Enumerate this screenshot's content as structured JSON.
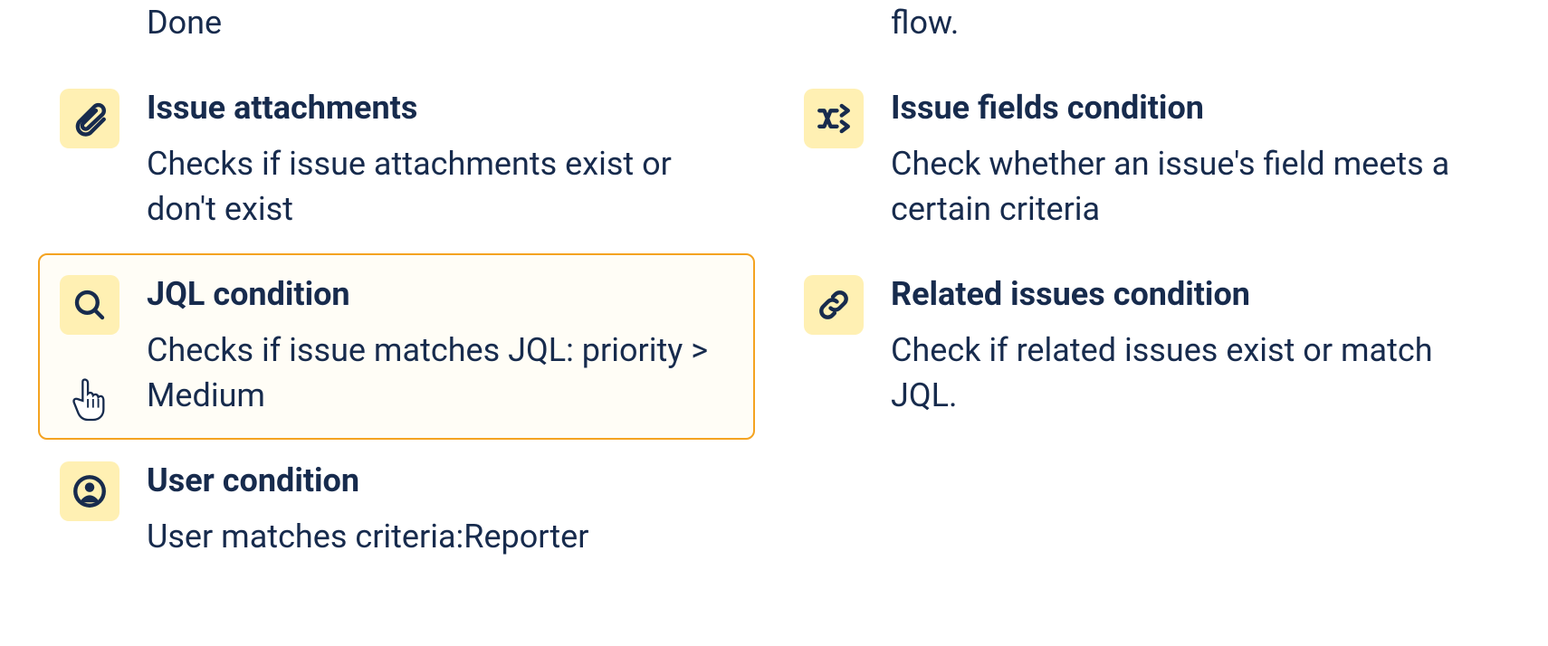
{
  "left": {
    "partial_top_desc": "Done",
    "items": [
      {
        "icon": "paperclip-icon",
        "title": "Issue attachments",
        "desc": "Checks if issue attachments exist or don't exist"
      },
      {
        "icon": "search-icon",
        "title": "JQL condition",
        "desc": "Checks if issue matches JQL: priority > Medium",
        "selected": true
      },
      {
        "icon": "user-circle-icon",
        "title": "User condition",
        "desc": "User matches criteria:Reporter"
      }
    ]
  },
  "right": {
    "partial_top_desc": "flow.",
    "items": [
      {
        "icon": "shuffle-icon",
        "title": "Issue fields condition",
        "desc": "Check whether an issue's field meets a certain criteria"
      },
      {
        "icon": "link-icon",
        "title": "Related issues condition",
        "desc": "Check if related issues exist or match JQL."
      }
    ]
  }
}
